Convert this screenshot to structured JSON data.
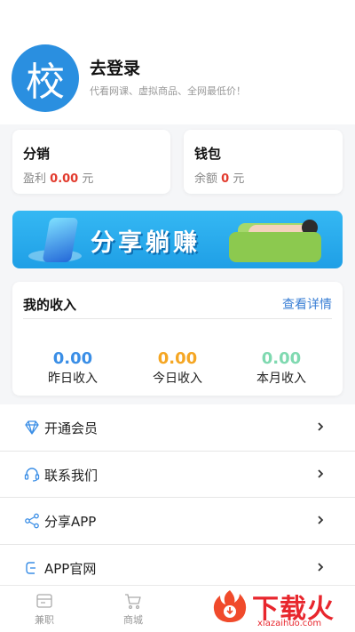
{
  "profile": {
    "avatar_char": "校",
    "login_label": "去登录",
    "subtitle": "代看网课、虚拟商品、全网最低价！"
  },
  "cards": {
    "distribution": {
      "title": "分销",
      "prefix": "盈利",
      "value": "0.00",
      "unit": "元"
    },
    "wallet": {
      "title": "钱包",
      "prefix": "余额",
      "value": "0",
      "unit": "元"
    }
  },
  "banner": {
    "text": "分享躺赚"
  },
  "income": {
    "title": "我的收入",
    "detail_link": "查看详情",
    "stats": [
      {
        "value": "0.00",
        "label": "昨日收入",
        "color": "#3a8ee6"
      },
      {
        "value": "0.00",
        "label": "今日收入",
        "color": "#f5a623"
      },
      {
        "value": "0.00",
        "label": "本月收入",
        "color": "#7fd9b0"
      }
    ]
  },
  "menu": [
    {
      "label": "开通会员",
      "icon": "diamond-icon"
    },
    {
      "label": "联系我们",
      "icon": "headset-icon"
    },
    {
      "label": "分享APP",
      "icon": "share-icon"
    },
    {
      "label": "APP官网",
      "icon": "link-icon"
    }
  ],
  "tabbar": [
    {
      "label": "兼职",
      "icon": "job-icon"
    },
    {
      "label": "商城",
      "icon": "cart-icon"
    }
  ],
  "watermark": {
    "text": "下载火",
    "url": "xiazaihuo.com"
  },
  "colors": {
    "accent": "#2a8fe0",
    "money_red": "#e23b2e",
    "link": "#3a7fd5"
  }
}
